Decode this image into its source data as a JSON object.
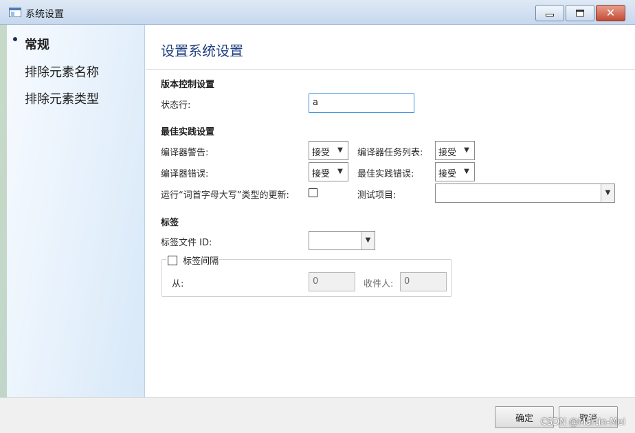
{
  "window": {
    "title": "系统设置",
    "icons": {
      "app": "window-icon",
      "minimize": "minimize-icon",
      "maximize": "maximize-icon",
      "close": "close-icon"
    }
  },
  "nav": {
    "items": [
      {
        "label": "常规",
        "active": true
      },
      {
        "label": "排除元素名称",
        "active": false
      },
      {
        "label": "排除元素类型",
        "active": false
      }
    ]
  },
  "main": {
    "title": "设置系统设置",
    "version_control": {
      "heading": "版本控制设置",
      "status_label": "状态行:",
      "status_value": "a"
    },
    "best_practice": {
      "heading": "最佳实践设置",
      "compiler_warning_label": "编译器警告:",
      "compiler_warning_value": "接受",
      "compiler_task_label": "编译器任务列表:",
      "compiler_task_value": "接受",
      "compiler_error_label": "编译器错误:",
      "compiler_error_value": "接受",
      "best_practice_error_label": "最佳实践错误:",
      "best_practice_error_value": "接受",
      "run_update_label": "运行“词首字母大写”类型的更新:",
      "run_update_checked": false,
      "test_project_label": "测试项目:",
      "test_project_value": ""
    },
    "labels": {
      "heading": "标签",
      "label_file_id_label": "标签文件 ID:",
      "label_file_id_value": "",
      "label_interval_label": "标签间隔",
      "label_interval_checked": false,
      "from_label": "从:",
      "from_value": "0",
      "recipient_label": "收件人:",
      "recipient_value": "0"
    }
  },
  "footer": {
    "ok_label": "确定",
    "cancel_label": "取消"
  },
  "watermark": "CSDN @Martin-Mei",
  "colors": {
    "title_blue": "#1f3f7f",
    "focus_border": "#3a8fd9",
    "close_red": "#c24a34"
  }
}
